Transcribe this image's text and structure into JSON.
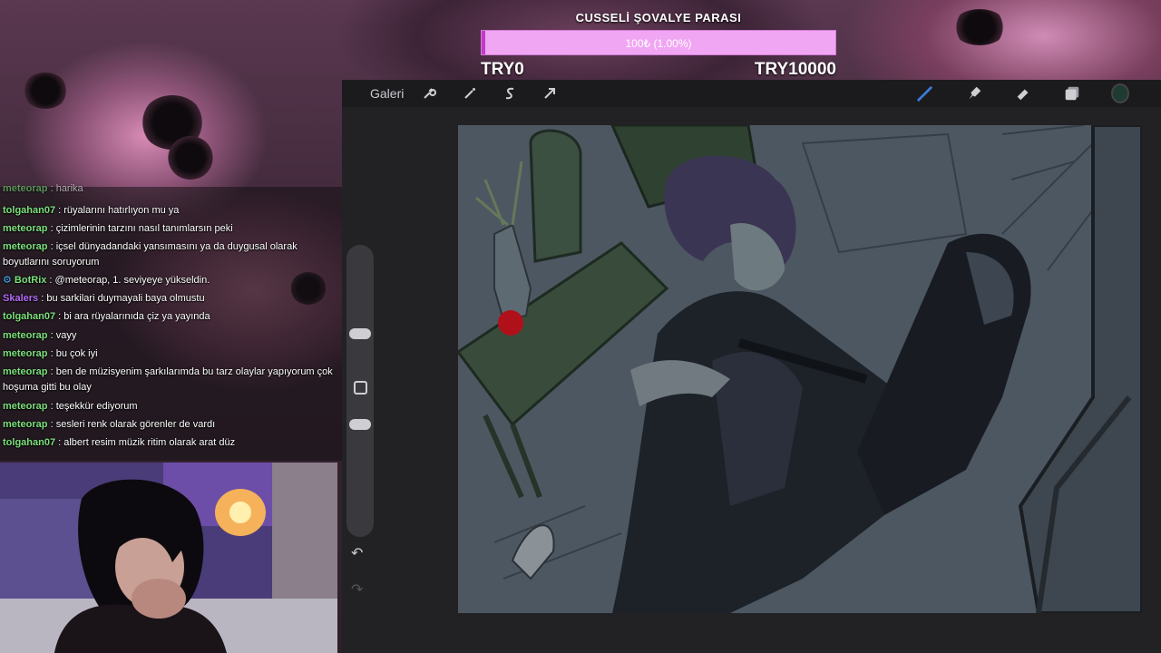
{
  "goal": {
    "title": "CUSSELİ ŞOVALYE PARASI",
    "bar_text": "100₺ (1.00%)",
    "progress_percent": 1.0,
    "min_label": "TRY0",
    "max_label": "TRY10000",
    "bar_color": "#f0a6f2",
    "fill_color": "#c03cc6"
  },
  "toolbar": {
    "gallery_label": "Galeri",
    "left_icons": [
      "wrench-icon",
      "magic-wand-icon",
      "selection-s-icon",
      "transform-arrow-icon"
    ],
    "right_icons": [
      "brush-icon",
      "smudge-icon",
      "eraser-icon",
      "layers-icon",
      "color-swatch-icon"
    ],
    "active_color": "#1f3a30",
    "brush_active_color": "#3d7bd9"
  },
  "chat": {
    "lines": [
      {
        "user": "meteorap",
        "color": "#7be07b",
        "text": ": harika"
      },
      {
        "user": "tolgahan07",
        "color": "#7be07b",
        "text": ": rüyalarını hatırlıyon mu ya"
      },
      {
        "user": "meteorap",
        "color": "#7be07b",
        "text": ": çizimlerinin tarzını nasıl tanımlarsın peki"
      },
      {
        "user": "meteorap",
        "color": "#7be07b",
        "text": ": içsel dünyadandaki yansımasını ya da duygusal olarak boyutlarını soruyorum"
      },
      {
        "user": "BotRix",
        "color": "#7be07b",
        "text": ": @meteorap, 1. seviyeye yükseldin.",
        "badge": true
      },
      {
        "user": "Skalers",
        "color": "#b36bf5",
        "text": ": bu sarkilari duymayali baya olmustu"
      },
      {
        "user": "tolgahan07",
        "color": "#7be07b",
        "text": ": bi ara rüyalarınıda çiz ya yayında"
      },
      {
        "user": "meteorap",
        "color": "#7be07b",
        "text": ": vayy"
      },
      {
        "user": "meteorap",
        "color": "#7be07b",
        "text": ": bu çok iyi"
      },
      {
        "user": "meteorap",
        "color": "#7be07b",
        "text": ": ben de müzisyenim şarkılarımda bu tarz olaylar yapıyorum çok hoşuma gitti bu olay"
      },
      {
        "user": "meteorap",
        "color": "#7be07b",
        "text": ": teşekkür ediyorum"
      },
      {
        "user": "meteorap",
        "color": "#7be07b",
        "text": ": sesleri renk olarak görenler de vardı"
      },
      {
        "user": "tolgahan07",
        "color": "#7be07b",
        "text": ": albert resim müzik ritim olarak arat düz"
      }
    ]
  }
}
